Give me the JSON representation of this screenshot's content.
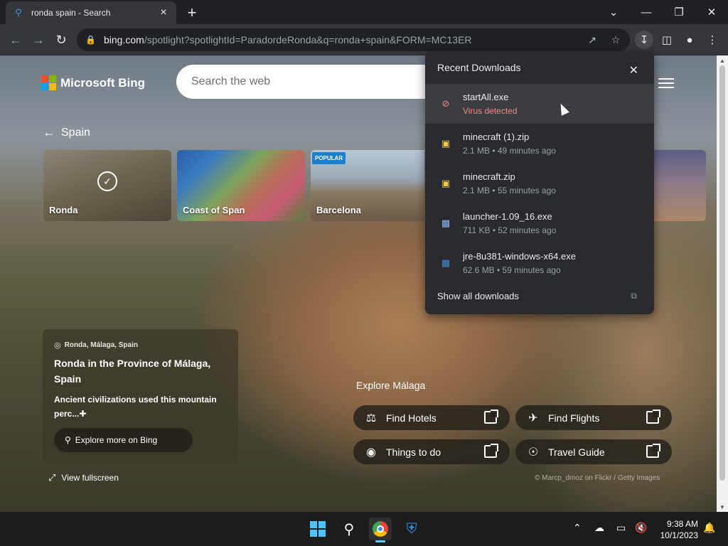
{
  "browser": {
    "tab_title": "ronda spain - Search",
    "url_host": "bing.com",
    "url_path": "/spotlight?spotlightId=ParadordeRonda&q=ronda+spain&FORM=MC13ER"
  },
  "bing": {
    "logo_text": "Microsoft Bing",
    "search_placeholder": "Search the web",
    "back_label": "Spain",
    "cards": [
      {
        "label": "Ronda"
      },
      {
        "label": "Coast of Span"
      },
      {
        "label": "Barcelona",
        "badge": "POPULAR"
      }
    ],
    "info": {
      "location": "Ronda, Málaga, Spain",
      "heading": "Ronda in the Province of Málaga, Spain",
      "description": "Ancient civilizations used this mountain perc...",
      "more_button": "Explore more on Bing"
    },
    "view_fullscreen": "View fullscreen",
    "explore_title": "Explore Málaga",
    "explore_buttons": [
      "Find Hotels",
      "Find Flights",
      "Things to do",
      "Travel Guide"
    ],
    "credit": "© Marcp_dmoz on Flickr / Getty Images"
  },
  "downloads": {
    "title": "Recent Downloads",
    "items": [
      {
        "name": "startAll.exe",
        "status": "Virus detected",
        "icon": "blocked-icon"
      },
      {
        "name": "minecraft (1).zip",
        "status": "2.1 MB • 49 minutes ago",
        "icon": "zip-folder-icon"
      },
      {
        "name": "minecraft.zip",
        "status": "2.1 MB • 55 minutes ago",
        "icon": "zip-folder-icon"
      },
      {
        "name": "launcher-1.09_16.exe",
        "status": "711 KB • 52 minutes ago",
        "icon": "exe-icon"
      },
      {
        "name": "jre-8u381-windows-x64.exe",
        "status": "62.6 MB • 59 minutes ago",
        "icon": "installer-icon"
      }
    ],
    "show_all": "Show all downloads"
  },
  "taskbar": {
    "time": "9:38 AM",
    "date": "10/1/2023"
  }
}
